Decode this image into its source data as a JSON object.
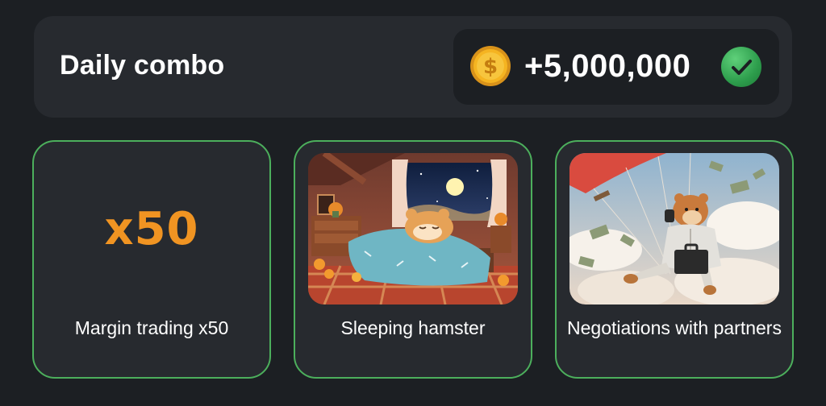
{
  "header": {
    "title": "Daily combo",
    "reward": "+5,000,000",
    "coin_icon": "dollar-coin-icon",
    "status_icon": "check-icon"
  },
  "cards": [
    {
      "big_text": "x50",
      "label": "Margin trading x50"
    },
    {
      "image": "hamster sleeping in bed at night",
      "label": "Sleeping hamster"
    },
    {
      "image": "hamster with briefcase parachuting among money",
      "label": "Negotiations with partners"
    }
  ],
  "colors": {
    "background": "#1c1f23",
    "panel": "#272a2f",
    "card_border": "#4caf5c",
    "accent_orange": "#f09422",
    "check_green": "#2d9d4c",
    "coin_gold": "#f5b421"
  }
}
